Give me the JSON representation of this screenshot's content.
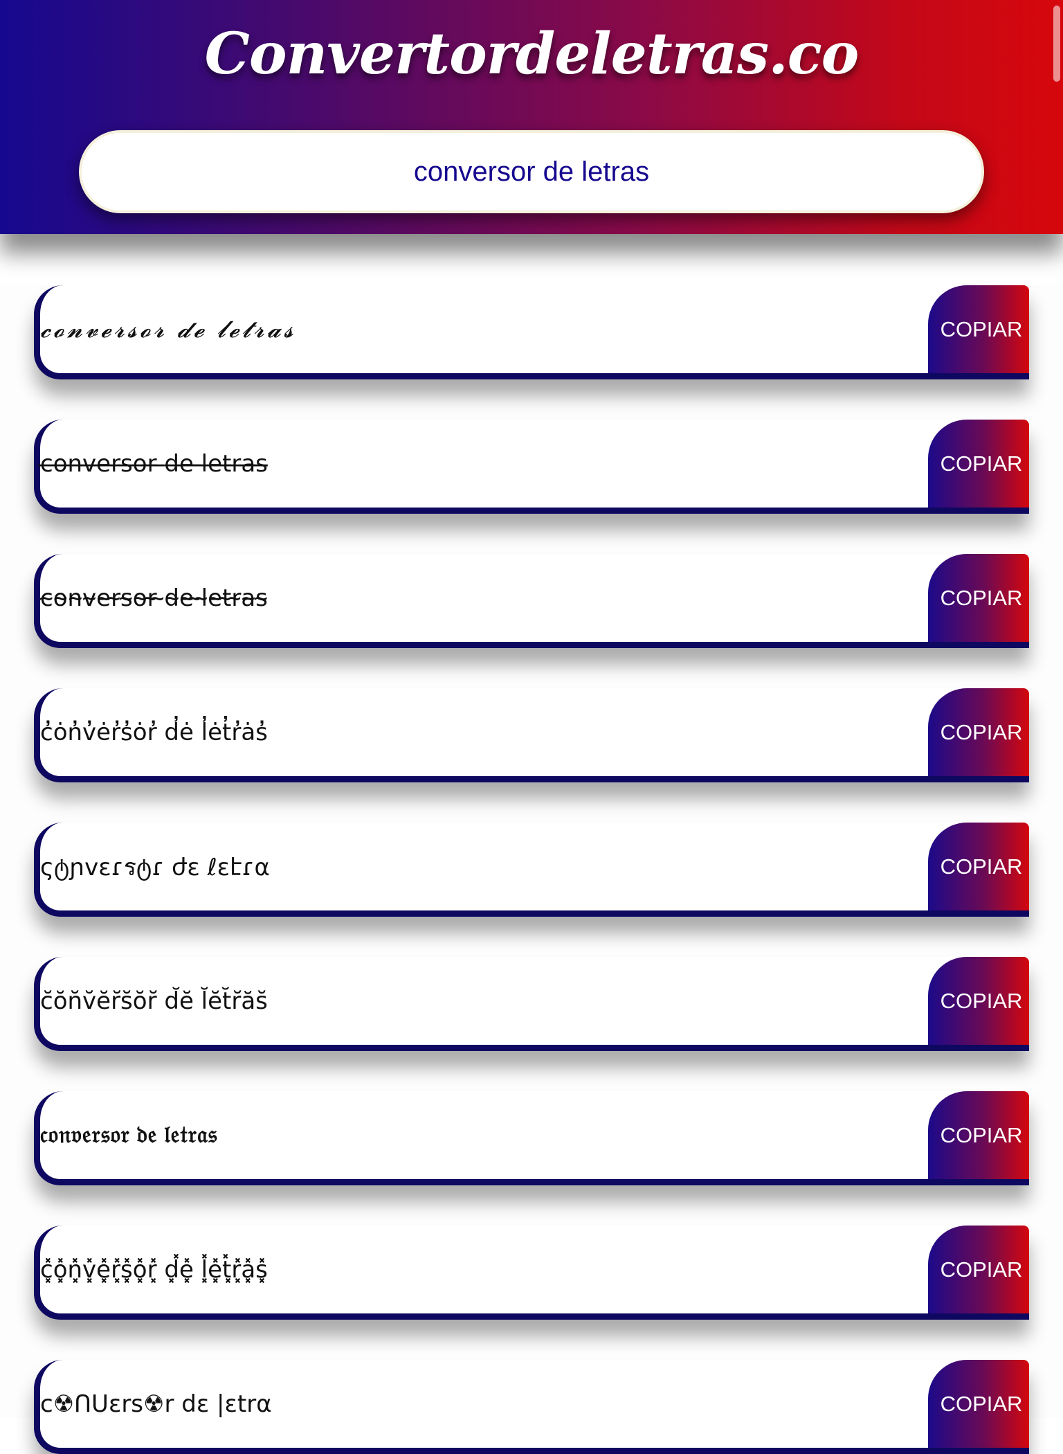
{
  "header": {
    "brand": "Convertordeletras.co",
    "search_value": "conversor de letras"
  },
  "results": [
    {
      "text": "𝓬𝓸𝓷𝓿𝓮𝓻𝓼𝓸𝓻 𝓭𝓮 𝓵𝓮𝓽𝓻𝓪𝓼",
      "button": "COPIAR"
    },
    {
      "text": "c̶o̶n̶v̶e̶r̶s̶o̶r̶ ̶d̶e̶ ̶l̶e̶t̶r̶a̶s̶",
      "button": "COPIAR"
    },
    {
      "text": "c̴o̴n̴v̴e̴r̴s̴o̴r̴ ̴d̴e̴ ̴l̴e̴t̴r̴a̴s̴",
      "button": "COPIAR"
    },
    {
      "text": "c̓ȯn̓v̓ėr̓s̓ȯr̓ d̓ė l̓ėt̓r̓ȧs̓",
      "button": "COPIAR"
    },
    {
      "text": "ςტɲvɛɾรტɾ ժɛ ℓɛէɾα",
      "button": "COPIAR"
    },
    {
      "text": "c̆ŏn̆v̆ĕr̆s̆ŏr̆ d̆ĕ l̆ĕt̆r̆ăs̆",
      "button": "COPIAR"
    },
    {
      "text": "𝔠𝔬𝔫𝔳𝔢𝔯𝔰𝔬𝔯 𝔡𝔢 𝔩𝔢𝔱𝔯𝔞𝔰",
      "button": "COPIAR"
    },
    {
      "text": "c͓̽o͓̽n͓̽v͓̽e͓̽r͓̽s͓̽o͓̽r͓̽ d͓̽e͓̽ l͓̽e͓̽t͓̽r͓̽a͓̽s͓̽",
      "button": "COPIAR"
    },
    {
      "text": "c☢ᑎᑌɛrs☢r dɛ |ɛtrα",
      "button": "COPIAR"
    }
  ]
}
